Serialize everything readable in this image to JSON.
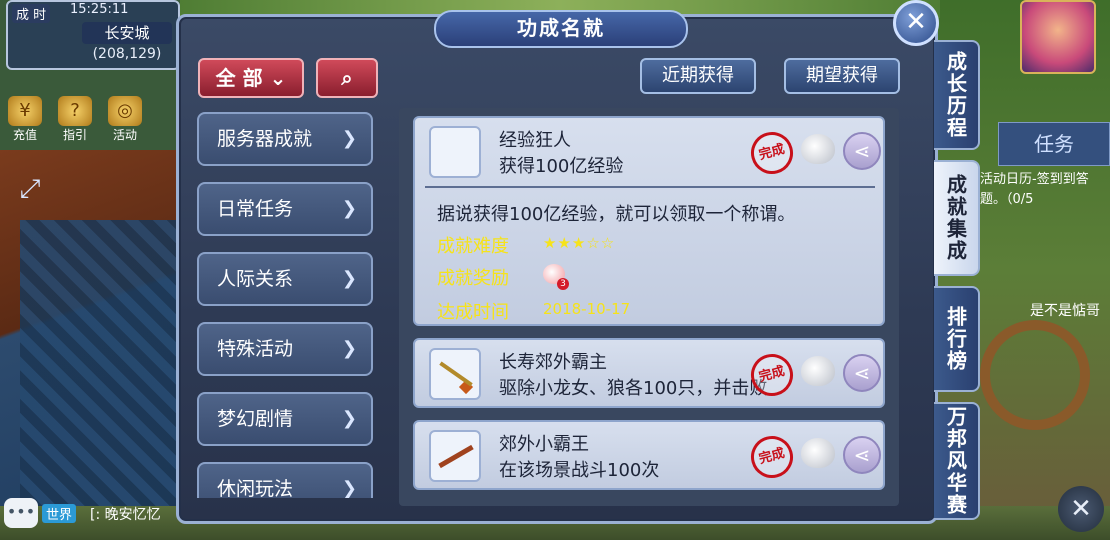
{
  "hud": {
    "badge": "成 时",
    "time": "15:25:11",
    "city": "长安城",
    "coord": "(208,129)",
    "icons": [
      {
        "label": "充值",
        "icon": "recharge-icon"
      },
      {
        "label": "指引",
        "icon": "guide-icon"
      },
      {
        "label": "活动",
        "icon": "activity-icon"
      }
    ],
    "chat_channel": "世界",
    "chat_msg": "[: 晚安忆忆"
  },
  "right_hud": {
    "task_tab": "任务",
    "task_text": "活动日历-签到到答题。（0/5",
    "chat_line": "是不是惦哥"
  },
  "panel": {
    "title": "功成名就",
    "filter_label": "全 部",
    "recent_btn": "近期获得",
    "expect_btn": "期望获得",
    "categories": [
      {
        "label": "服务器成就"
      },
      {
        "label": "日常任务"
      },
      {
        "label": "人际关系"
      },
      {
        "label": "特殊活动"
      },
      {
        "label": "梦幻剧情"
      },
      {
        "label": "休闲玩法"
      }
    ],
    "side_tabs": [
      {
        "label": "成长历程"
      },
      {
        "label": "成就集成"
      },
      {
        "label": "排行榜"
      },
      {
        "label": "万邦风华赛"
      }
    ],
    "achievements": [
      {
        "name": "经验狂人",
        "desc": "获得100亿经验",
        "icon": "crescent-moon-icon",
        "seal": "完成",
        "detail": "据说获得100亿经验，就可以领取一个称谓。",
        "difficulty_label": "成就难度",
        "difficulty_stars": "★★★☆☆",
        "difficulty_value": 3,
        "reward_label": "成就奖励",
        "reward_count": "3",
        "date_label": "达成时间",
        "date": "2018-10-17"
      },
      {
        "name": "长寿郊外霸主",
        "desc": "驱除小龙女、狼各100只，并击败",
        "icon": "spear-icon",
        "seal": "完成"
      },
      {
        "name": "郊外小霸王",
        "desc": "在该场景战斗100次",
        "icon": "staff-icon",
        "seal": "完成"
      }
    ]
  },
  "colors": {
    "panel_bg": "#2e3a54",
    "card_bg": "#c9d3e6",
    "accent_red": "#c8101a",
    "highlight_yellow": "#f6e31a"
  }
}
